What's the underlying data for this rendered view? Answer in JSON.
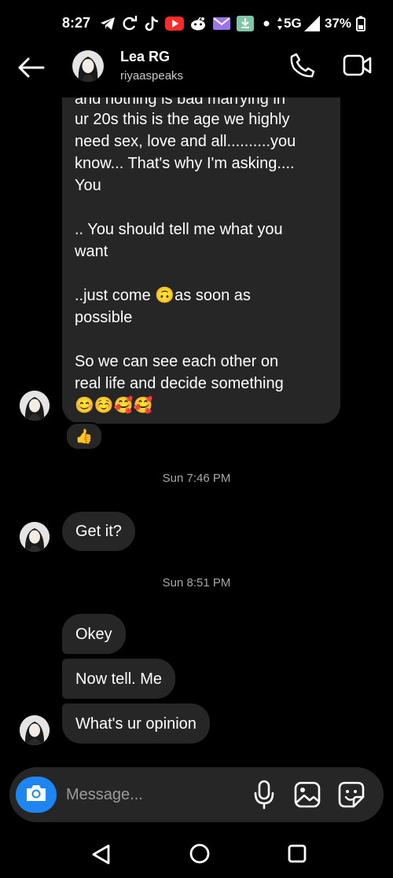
{
  "status_bar": {
    "time": "8:27",
    "network": "5G",
    "battery": "37%",
    "notification_icons": [
      "telegram-icon",
      "sync-icon",
      "tiktok-icon",
      "youtube-icon",
      "reddit-icon",
      "mail-icon",
      "download-icon"
    ]
  },
  "header": {
    "name": "Lea RG",
    "username": "riyaaspeaks",
    "icons": [
      "back-arrow-icon",
      "phone-icon",
      "video-camera-icon"
    ]
  },
  "messages": {
    "big": {
      "partial_line": "and nothing is bad marrying in",
      "body": "ur 20s this is the age we highly\nneed sex, love and all..........you\nknow... That's why I'm asking....\nYou\n\n.. You should tell me what you\nwant\n\n..just come 🙃as soon as\npossible\n\nSo we can see each other on\nreal life and decide something\n😊☺️🥰🥰",
      "reaction": "👍"
    },
    "stamp1": "Sun 7:46 PM",
    "get_it": "Get it?",
    "stamp2": "Sun 8:51 PM",
    "okey": "Okey",
    "now_tell": "Now tell. Me",
    "opinion": "What's ur opinion"
  },
  "composer": {
    "placeholder": "Message...",
    "icons": [
      "camera-icon",
      "microphone-icon",
      "gallery-icon",
      "sticker-icon"
    ]
  },
  "colors": {
    "background": "#000000",
    "bubble": "#262626",
    "accent": "#1e86f0",
    "muted_text": "#a8a8a8"
  }
}
